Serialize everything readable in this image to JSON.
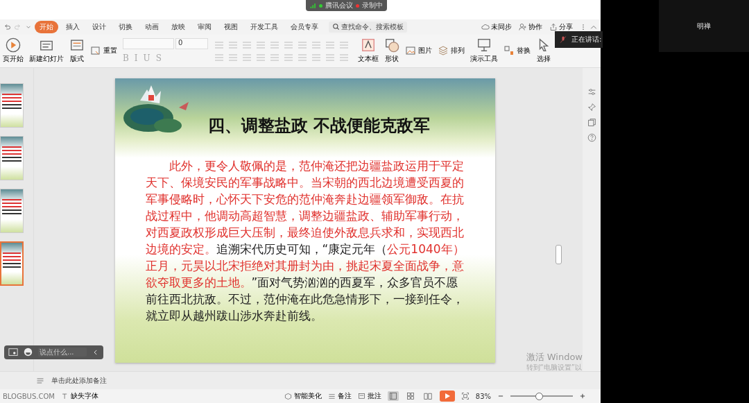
{
  "meeting_badge": {
    "app": "腾讯会议",
    "recording": "录制中"
  },
  "participant": {
    "name": "明禅"
  },
  "speaking": {
    "label": "正在讲话:"
  },
  "tabs": [
    {
      "label": "开始",
      "selected": true
    },
    {
      "label": "插入",
      "selected": false
    },
    {
      "label": "设计",
      "selected": false
    },
    {
      "label": "切换",
      "selected": false
    },
    {
      "label": "动画",
      "selected": false
    },
    {
      "label": "放映",
      "selected": false
    },
    {
      "label": "审阅",
      "selected": false
    },
    {
      "label": "视图",
      "selected": false
    },
    {
      "label": "开发工具",
      "selected": false
    },
    {
      "label": "会员专享",
      "selected": false
    }
  ],
  "search": {
    "placeholder": "查找命令、搜索模板"
  },
  "top_actions": [
    "未同步",
    "协作",
    "分享"
  ],
  "ribbon": {
    "left": [
      {
        "label": "页开始",
        "kind": "large"
      },
      {
        "label": "新建幻灯片",
        "kind": "large"
      },
      {
        "label": "版式",
        "kind": "large"
      },
      {
        "label": "重置",
        "kind": "small"
      }
    ],
    "font_size": "0",
    "format_buttons": [
      {
        "label": "B",
        "disabled": true
      },
      {
        "label": "I",
        "disabled": true
      },
      {
        "label": "U",
        "disabled": true
      },
      {
        "label": "S",
        "disabled": true
      }
    ],
    "right": [
      {
        "label": "文本框",
        "kind": "large"
      },
      {
        "label": "形状",
        "kind": "large"
      },
      {
        "label": "图片",
        "kind": "small"
      },
      {
        "label": "排列",
        "kind": "small"
      },
      {
        "label": "演示工具",
        "kind": "large"
      },
      {
        "label": "替换",
        "kind": "small"
      },
      {
        "label": "选择",
        "kind": "large"
      }
    ]
  },
  "thumbnails": [
    {
      "selected": false
    },
    {
      "selected": false
    },
    {
      "selected": false
    },
    {
      "selected": true
    }
  ],
  "slide": {
    "title": "四、调整盐政  不战便能克敌军",
    "paragraph": [
      {
        "text": "此外，更令人敬佩的是，范仲淹还把边疆盐政运用于平定天下、保境安民的军事战略中。当宋朝的西北边境遭受西夏的军事侵略时，心怀天下安危的范仲淹奔赴边疆领军御敌。在抗战过程中，他调动高超智慧，调整边疆盐政、辅助军事行动，对西夏政权形成巨大压制，最终迫使外敌息兵求和，实现西北边境的安定。",
        "emphasis": true
      },
      {
        "text": "追溯宋代历史可知，“康定元年（",
        "emphasis": false
      },
      {
        "text": "公元1040年）正月，元昊以北宋拒绝对其册封为由，挑起宋夏全面战争，意欲夺取更多的土地。",
        "emphasis": true
      },
      {
        "text": "”面对气势汹汹的西夏军，众多官员不愿前往西北抗敌。不过，范仲淹在此危急情形下，一接到任令，就立即从越州跋山涉水奔赴前线。",
        "emphasis": false
      }
    ]
  },
  "chat_bar": {
    "placeholder": "说点什么..."
  },
  "notes": {
    "placeholder": "单击此处添加备注"
  },
  "watermark": {
    "line1": "激活 Window",
    "line2": "转到“电脑设置”以"
  },
  "status_bar": {
    "site": "BLOGBUS.COM",
    "missing_font": "缺失字体",
    "beautify": "智能美化",
    "notes": "备注",
    "comments": "批注",
    "views": [
      {
        "selected": true
      },
      {
        "selected": false
      },
      {
        "selected": false
      }
    ],
    "zoom": "83%",
    "zoom_slider": {
      "level": 0.45
    }
  }
}
